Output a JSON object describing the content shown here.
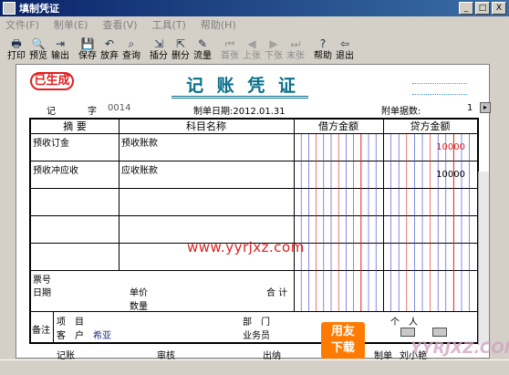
{
  "window": {
    "title": "填制凭证",
    "buttons": [
      "_",
      "□",
      "X"
    ]
  },
  "menu": [
    "文件(F)",
    "制单(E)",
    "查看(V)",
    "工具(T)",
    "帮助(H)"
  ],
  "toolbar": [
    {
      "label": "打印",
      "icon": "printer-icon",
      "glyph": "🖶",
      "enabled": true
    },
    {
      "label": "预览",
      "icon": "preview-icon",
      "glyph": "🔍",
      "enabled": true
    },
    {
      "label": "输出",
      "icon": "export-icon",
      "glyph": "⇥",
      "enabled": true
    },
    {
      "label": "保存",
      "icon": "save-icon",
      "glyph": "💾",
      "enabled": true
    },
    {
      "label": "放弃",
      "icon": "undo-icon",
      "glyph": "↶",
      "enabled": true
    },
    {
      "label": "查询",
      "icon": "binoculars-icon",
      "glyph": "⌕",
      "enabled": true
    },
    {
      "label": "插分",
      "icon": "insert-split-icon",
      "glyph": "⇲",
      "enabled": true
    },
    {
      "label": "删分",
      "icon": "delete-split-icon",
      "glyph": "⇱",
      "enabled": true
    },
    {
      "label": "流量",
      "icon": "flow-icon",
      "glyph": "✎",
      "enabled": true
    },
    {
      "label": "首张",
      "icon": "first-icon",
      "glyph": "⏮",
      "enabled": false
    },
    {
      "label": "上张",
      "icon": "prev-icon",
      "glyph": "◀",
      "enabled": false
    },
    {
      "label": "下张",
      "icon": "next-icon",
      "glyph": "▶",
      "enabled": false
    },
    {
      "label": "末张",
      "icon": "last-icon",
      "glyph": "⏭",
      "enabled": false
    },
    {
      "label": "帮助",
      "icon": "help-icon",
      "glyph": "?",
      "enabled": true
    },
    {
      "label": "退出",
      "icon": "exit-icon",
      "glyph": "⇦",
      "enabled": true
    }
  ],
  "voucher": {
    "stamp": "已生成",
    "title": "记 账 凭 证",
    "type_label": "记",
    "zi": "字",
    "number": "0014",
    "date_label": "制单日期:",
    "date": "2012.01.31",
    "attach_label": "附单据数:",
    "attach_count": "1",
    "headers": {
      "summary": "摘 要",
      "account": "科目名称",
      "debit": "借方金额",
      "credit": "贷方金额"
    },
    "rows": [
      {
        "summary": "预收订金",
        "account": "预收账款",
        "debit": "",
        "credit": "10000",
        "credit_red": true
      },
      {
        "summary": "预收冲应收",
        "account": "应收账款",
        "debit": "",
        "credit": "10000",
        "credit_red": false
      },
      {
        "summary": "",
        "account": "",
        "debit": "",
        "credit": ""
      },
      {
        "summary": "",
        "account": "",
        "debit": "",
        "credit": ""
      }
    ],
    "bill_no": "票号",
    "date_field": "日期",
    "unit_price": "单价",
    "quantity": "数量",
    "total": "合 计",
    "remarks": "备注",
    "project": "项　目",
    "customer_label": "客　户",
    "customer_value": "希亚",
    "department": "部　门",
    "person": "个　人",
    "salesman": "业务员"
  },
  "footer": {
    "bookkeeping": "记账",
    "audit": "审核",
    "cashier": "出纳",
    "maker": "制单",
    "maker_name": "刘小艳"
  },
  "watermark": "www.yyrjxz.com",
  "brand": {
    "logo_line1": "用友",
    "logo_line2": "下载",
    "site": "YYRJXZ.COM"
  },
  "colors": {
    "title": "#0b6f87",
    "stamp": "#e02020",
    "debit_lines": "#3b3bd0",
    "credit_lines": "#e02020"
  }
}
